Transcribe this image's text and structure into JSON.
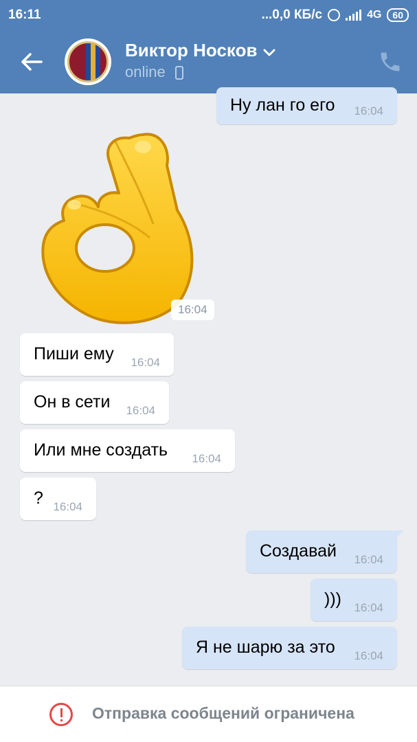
{
  "status_bar": {
    "time": "16:11",
    "network_speed": "...0,0 КБ/с",
    "network_type": "4G",
    "battery": "60",
    "icons": [
      "alarm-icon",
      "signal-icon",
      "battery-icon"
    ]
  },
  "header": {
    "contact_name": "Виктор Носков",
    "status": "online",
    "icons": [
      "back-arrow-icon",
      "chevron-down-icon",
      "mobile-phone-icon",
      "call-icon"
    ]
  },
  "messages": [
    {
      "direction": "out",
      "text": "Ну лан го его",
      "time": "16:04"
    },
    {
      "direction": "in",
      "type": "sticker",
      "sticker": "ok-hand-sticker",
      "time": "16:04"
    },
    {
      "direction": "in",
      "text": "Пиши ему",
      "time": "16:04"
    },
    {
      "direction": "in",
      "text": "Он в сети",
      "time": "16:04"
    },
    {
      "direction": "in",
      "text": "Или мне создать",
      "time": "16:04"
    },
    {
      "direction": "in",
      "text": "?",
      "time": "16:04"
    },
    {
      "direction": "out",
      "text": "Создавай",
      "time": "16:04"
    },
    {
      "direction": "out",
      "text": ")))",
      "time": "16:04"
    },
    {
      "direction": "out",
      "text": "Я не шарю за это",
      "time": "16:04"
    }
  ],
  "footer": {
    "notice": "Отправка сообщений ограничена",
    "icon": "warning-circle-icon"
  },
  "colors": {
    "header": "#5181b8",
    "background": "#ebedf0",
    "outgoing_bubble": "#d6e4f7",
    "incoming_bubble": "#ffffff",
    "warning": "#e64646"
  }
}
